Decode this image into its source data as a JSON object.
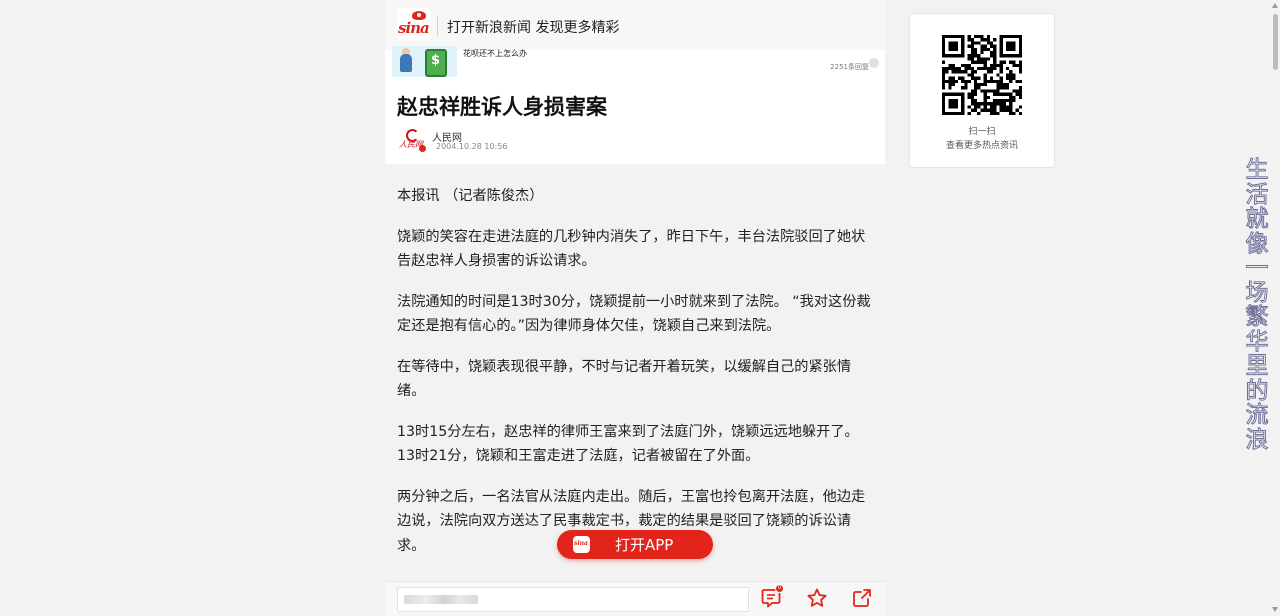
{
  "topbar": {
    "logo_text": "sina",
    "slogan": "打开新浪新闻 发现更多精彩"
  },
  "related": {
    "caption": "花呗还不上怎么办",
    "count": "2251条回复"
  },
  "article": {
    "title": "赵忠祥胜诉人身损害案",
    "source_logo_text": "人民网",
    "source": "人民网",
    "datetime": "2004.10.28  10:56",
    "paragraphs": [
      "本报讯 （记者陈俊杰）",
      "饶颖的笑容在走进法庭的几秒钟内消失了，昨日下午，丰台法院驳回了她状告赵忠祥人身损害的诉讼请求。",
      "法院通知的时间是13时30分，饶颖提前一小时就来到了法院。 “我对这份裁定还是抱有信心的。”因为律师身体欠佳，饶颖自己来到法院。",
      "在等待中，饶颖表现很平静，不时与记者开着玩笑，以缓解自己的紧张情绪。",
      "13时15分左右，赵忠祥的律师王富来到了法庭门外，饶颖远远地躲开了。13时21分，饶颖和王富走进了法庭，记者被留在了外面。",
      "两分钟之后，一名法官从法庭内走出。随后，王富也拎包离开法庭，他边走边说，法院向双方送达了民事裁定书，裁定的结果是驳回了饶颖的诉讼请求。"
    ]
  },
  "open_app": {
    "label": "打开APP",
    "icon": "sina-app-icon"
  },
  "bottombar": {
    "comment_badge": "0",
    "icons": [
      "comment-icon",
      "star-icon",
      "share-icon"
    ]
  },
  "qr": {
    "line1": "扫一扫",
    "line2": "查看更多热点资讯"
  },
  "side_slogan": "生活就像一场繁华里的流浪",
  "colors": {
    "brand_red": "#e1251b",
    "background": "#f2f2f2"
  }
}
